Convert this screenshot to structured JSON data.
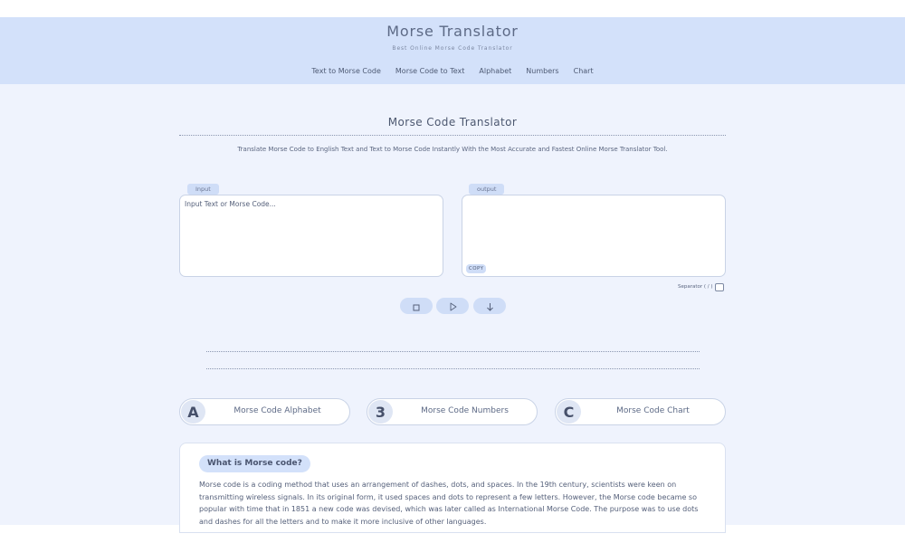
{
  "header": {
    "title": "Morse Translator",
    "subtitle": "Best Online Morse Code Translator",
    "nav": [
      "Text to Morse Code",
      "Morse Code to Text",
      "Alphabet",
      "Numbers",
      "Chart"
    ]
  },
  "translator": {
    "title": "Morse Code Translator",
    "description": "Translate Morse Code to English Text and Text to Morse Code Instantly With the Most Accurate and Fastest Online Morse Translator Tool.",
    "input_label": "Input",
    "input_placeholder": "Input Text or Morse Code...",
    "input_value": "",
    "output_label": "output",
    "output_value": "",
    "copy_label": "COPY",
    "separator_label": "Separator ( / )",
    "separator_checked": false,
    "controls": [
      {
        "icon": "stop-icon"
      },
      {
        "icon": "play-icon"
      },
      {
        "icon": "download-icon"
      }
    ]
  },
  "cards": [
    {
      "icon_char": "A",
      "icon": "letter-a-icon",
      "label": "Morse Code Alphabet"
    },
    {
      "icon_char": "3",
      "icon": "number-3-icon",
      "label": "Morse Code Numbers"
    },
    {
      "icon_char": "C",
      "icon": "chart-c-icon",
      "label": "Morse Code Chart"
    }
  ],
  "article": {
    "heading": "What is Morse code?",
    "body": "Morse code is a coding method that uses an arrangement of dashes, dots, and spaces. In the 19th century, scientists were keen on transmitting wireless signals. In its original form, it used spaces and dots to represent a few letters. However, the Morse code became so popular with time that in 1851 a new code was devised, which was later called as International Morse Code. The purpose was to use dots and dashes for all the letters and to make it more inclusive of other languages."
  },
  "colors": {
    "header_bg": "#d3e1fa",
    "main_bg": "#eff3fd",
    "accent": "#cfddf7",
    "text": "#5a6478"
  }
}
